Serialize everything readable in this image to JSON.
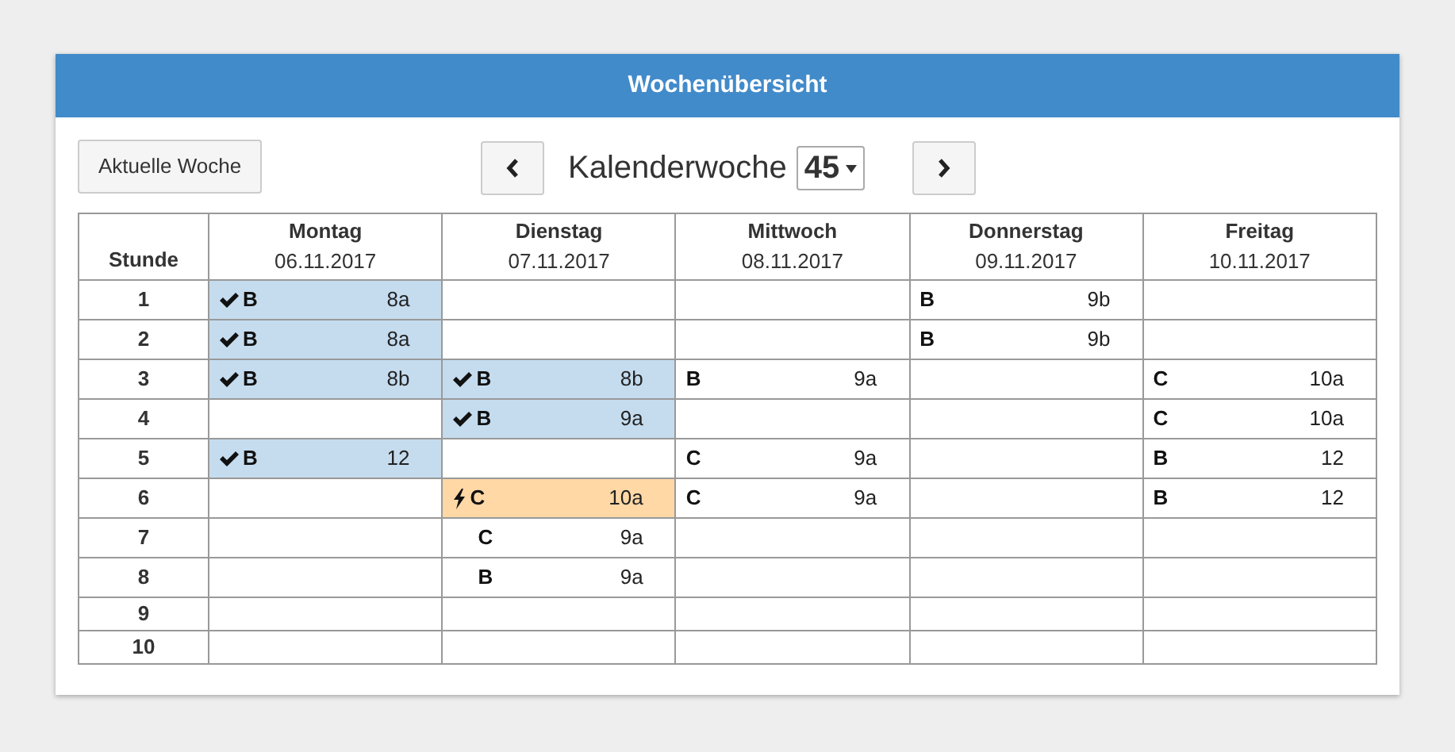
{
  "title": "Wochenübersicht",
  "current_week_button": "Aktuelle Woche",
  "week_label": "Kalenderwoche",
  "week_select": "45",
  "hour_header": "Stunde",
  "days": [
    {
      "day": "Montag",
      "date": "06.11.2017"
    },
    {
      "day": "Dienstag",
      "date": "07.11.2017"
    },
    {
      "day": "Mittwoch",
      "date": "08.11.2017"
    },
    {
      "day": "Donnerstag",
      "date": "09.11.2017"
    },
    {
      "day": "Freitag",
      "date": "10.11.2017"
    }
  ],
  "rows": [
    {
      "hour": "1",
      "cells": [
        {
          "kind": "done",
          "subject": "B",
          "group": "8a"
        },
        null,
        null,
        {
          "kind": "open",
          "subject": "B",
          "group": "9b"
        },
        null
      ]
    },
    {
      "hour": "2",
      "cells": [
        {
          "kind": "done",
          "subject": "B",
          "group": "8a"
        },
        null,
        null,
        {
          "kind": "open",
          "subject": "B",
          "group": "9b"
        },
        null
      ]
    },
    {
      "hour": "3",
      "cells": [
        {
          "kind": "done",
          "subject": "B",
          "group": "8b"
        },
        {
          "kind": "done",
          "subject": "B",
          "group": "8b"
        },
        {
          "kind": "open",
          "subject": "B",
          "group": "9a"
        },
        null,
        {
          "kind": "open",
          "subject": "C",
          "group": "10a"
        }
      ]
    },
    {
      "hour": "4",
      "cells": [
        null,
        {
          "kind": "done",
          "subject": "B",
          "group": "9a"
        },
        null,
        null,
        {
          "kind": "open",
          "subject": "C",
          "group": "10a"
        }
      ]
    },
    {
      "hour": "5",
      "cells": [
        {
          "kind": "done",
          "subject": "B",
          "group": "12"
        },
        null,
        {
          "kind": "open",
          "subject": "C",
          "group": "9a"
        },
        null,
        {
          "kind": "open",
          "subject": "B",
          "group": "12"
        }
      ]
    },
    {
      "hour": "6",
      "cells": [
        null,
        {
          "kind": "conflict",
          "subject": "C",
          "group": "10a"
        },
        {
          "kind": "open",
          "subject": "C",
          "group": "9a"
        },
        null,
        {
          "kind": "open",
          "subject": "B",
          "group": "12"
        }
      ]
    },
    {
      "hour": "7",
      "cells": [
        null,
        {
          "kind": "pending",
          "subject": "C",
          "group": "9a"
        },
        null,
        null,
        null
      ]
    },
    {
      "hour": "8",
      "cells": [
        null,
        {
          "kind": "pending",
          "subject": "B",
          "group": "9a"
        },
        null,
        null,
        null
      ]
    },
    {
      "hour": "9",
      "cells": [
        null,
        null,
        null,
        null,
        null
      ]
    },
    {
      "hour": "10",
      "cells": [
        null,
        null,
        null,
        null,
        null
      ]
    }
  ]
}
